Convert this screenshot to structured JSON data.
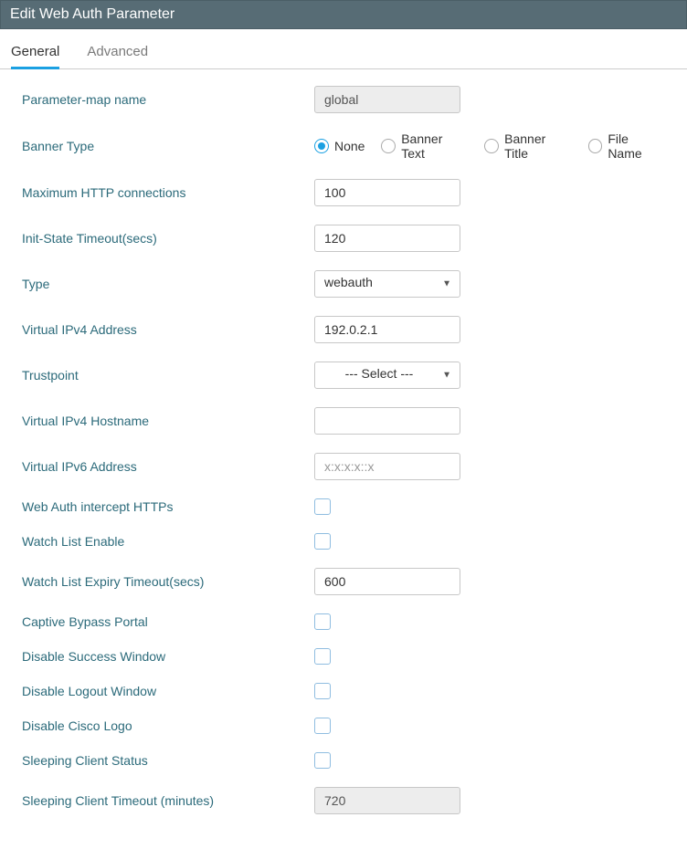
{
  "header": {
    "title": "Edit Web Auth Parameter"
  },
  "tabs": {
    "general": "General",
    "advanced": "Advanced",
    "active": "general"
  },
  "labels": {
    "param_map_name": "Parameter-map name",
    "banner_type": "Banner Type",
    "max_http_conn": "Maximum HTTP connections",
    "init_state_timeout": "Init-State Timeout(secs)",
    "type": "Type",
    "virtual_ipv4_addr": "Virtual IPv4 Address",
    "trustpoint": "Trustpoint",
    "virtual_ipv4_host": "Virtual IPv4 Hostname",
    "virtual_ipv6_addr": "Virtual IPv6 Address",
    "web_auth_intercept": "Web Auth intercept HTTPs",
    "watch_list_enable": "Watch List Enable",
    "watch_list_expiry": "Watch List Expiry Timeout(secs)",
    "captive_bypass": "Captive Bypass Portal",
    "disable_success": "Disable Success Window",
    "disable_logout": "Disable Logout Window",
    "disable_logo": "Disable Cisco Logo",
    "sleeping_status": "Sleeping Client Status",
    "sleeping_timeout": "Sleeping Client Timeout (minutes)"
  },
  "values": {
    "param_map_name": "global",
    "max_http_conn": "100",
    "init_state_timeout": "120",
    "type": "webauth",
    "virtual_ipv4_addr": "192.0.2.1",
    "trustpoint": "--- Select ---",
    "virtual_ipv4_host": "",
    "virtual_ipv6_addr": "",
    "watch_list_expiry": "600",
    "sleeping_timeout": "720"
  },
  "placeholders": {
    "virtual_ipv6_addr": "x:x:x:x::x"
  },
  "banner_options": {
    "none": "None",
    "banner_text": "Banner Text",
    "banner_title": "Banner Title",
    "file_name": "File Name",
    "selected": "none"
  },
  "checkboxes": {
    "web_auth_intercept": false,
    "watch_list_enable": false,
    "captive_bypass": false,
    "disable_success": false,
    "disable_logout": false,
    "disable_logo": false,
    "sleeping_status": false
  }
}
